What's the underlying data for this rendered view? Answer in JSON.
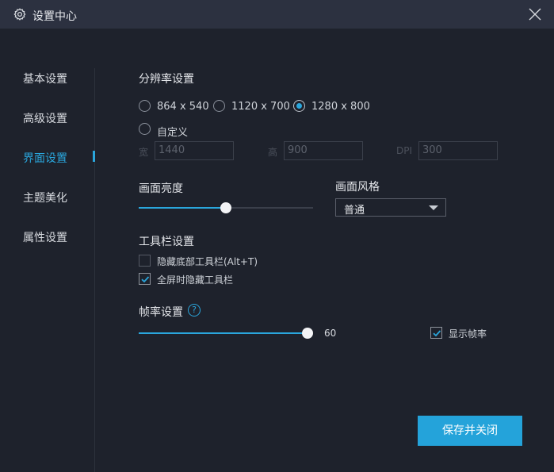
{
  "window": {
    "title": "设置中心",
    "icon": "gear-icon",
    "close_icon": "close-icon"
  },
  "sidebar": {
    "items": [
      {
        "label": "基本设置",
        "active": false
      },
      {
        "label": "高级设置",
        "active": false
      },
      {
        "label": "界面设置",
        "active": true
      },
      {
        "label": "主题美化",
        "active": false
      },
      {
        "label": "属性设置",
        "active": false
      }
    ]
  },
  "resolution": {
    "title": "分辨率设置",
    "options": [
      {
        "label": "864 x 540",
        "checked": false
      },
      {
        "label": "1120 x 700",
        "checked": false
      },
      {
        "label": "1280 x 800",
        "checked": true
      },
      {
        "label": "自定义",
        "checked": false
      }
    ],
    "width_label": "宽",
    "width_value": "1440",
    "height_label": "高",
    "height_value": "900",
    "dpi_label": "DPI",
    "dpi_value": "300"
  },
  "brightness": {
    "title": "画面亮度",
    "level": 0.5
  },
  "style": {
    "title": "画面风格",
    "selected": "普通"
  },
  "toolbar": {
    "title": "工具栏设置",
    "options": [
      {
        "label": "隐藏底部工具栏(Alt+T)",
        "checked": false
      },
      {
        "label": "全屏时隐藏工具栏",
        "checked": true
      }
    ]
  },
  "framerate": {
    "title": "帧率设置",
    "help_icon": "question-icon",
    "help_glyph": "?",
    "value": "60",
    "level": 1.0,
    "show_fps_label": "显示帧率",
    "show_fps_checked": true
  },
  "actions": {
    "save_label": "保存并关闭"
  },
  "colors": {
    "accent": "#2aa6dc",
    "background": "#1e222c",
    "titlebar": "#2c3140",
    "button": "#24a3da"
  }
}
